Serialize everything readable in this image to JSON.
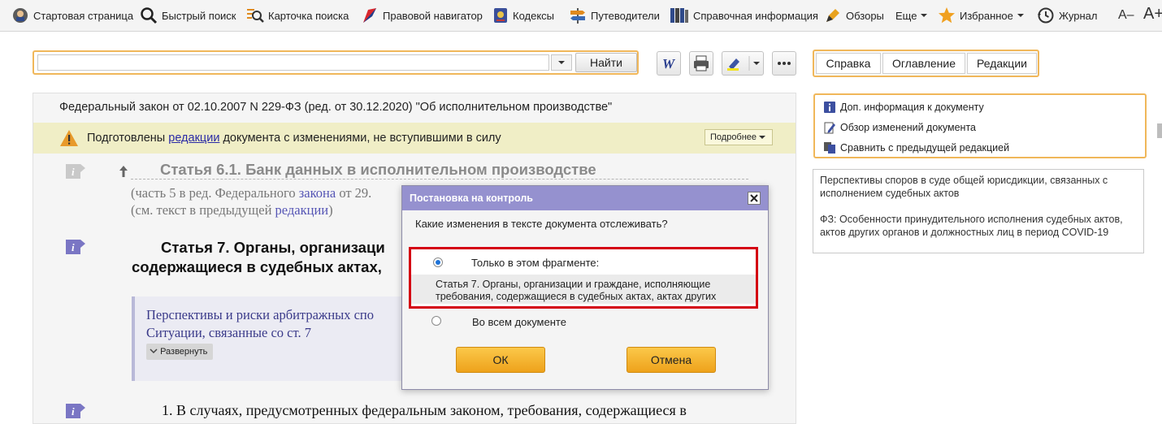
{
  "toolbar": {
    "items": [
      {
        "label": "Стартовая страница",
        "icon": "start-page-icon"
      },
      {
        "label": "Быстрый поиск",
        "icon": "search-icon"
      },
      {
        "label": "Карточка поиска",
        "icon": "search-card-icon"
      },
      {
        "label": "Правовой навигатор",
        "icon": "navigator-icon"
      },
      {
        "label": "Кодексы",
        "icon": "codes-icon"
      },
      {
        "label": "Путеводители",
        "icon": "guides-icon"
      },
      {
        "label": "Справочная информация",
        "icon": "reference-icon"
      },
      {
        "label": "Обзоры",
        "icon": "reviews-icon"
      },
      {
        "label": "Еще",
        "icon": "chevron-down-icon"
      },
      {
        "label": "Избранное",
        "icon": "star-icon"
      },
      {
        "label": "Журнал",
        "icon": "history-icon"
      }
    ],
    "font_decrease": "A–",
    "font_increase": "A+"
  },
  "search": {
    "value": "",
    "button_label": "Найти"
  },
  "right_tabs": [
    "Справка",
    "Оглавление",
    "Редакции"
  ],
  "document": {
    "title": "Федеральный закон от 02.10.2007 N 229-ФЗ (ред. от 30.12.2020) \"Об исполнительном производстве\"",
    "notice": {
      "before": "Подготовлены ",
      "link": "редакции",
      "after": " документа с изменениями, не вступившими в силу",
      "more_button": "Подробнее"
    },
    "article61": {
      "heading": "Статья 6.1. Банк данных в исполнительном производстве",
      "line1_before": "(часть 5 в ред. Федерального ",
      "line1_link": "закона",
      "line1_after": " от 29.",
      "line2_before": "(см. текст в предыдущей ",
      "line2_link": "редакции",
      "line2_after": ")"
    },
    "article7": {
      "line1": "Статья 7. Органы, организаци",
      "line2": "содержащиеся в судебных актах,"
    },
    "comment": {
      "line1": "Перспективы и риски арбитражных спо",
      "line2": "Ситуации, связанные со ст. 7",
      "expand_button": "Развернуть"
    },
    "paragraph1": "1. В случаях, предусмотренных федеральным законом, требования, содержащиеся в"
  },
  "right_panel": {
    "info_links": [
      {
        "label": "Доп. информация к документу",
        "icon": "info-icon"
      },
      {
        "label": "Обзор изменений документа",
        "icon": "edit-doc-icon"
      },
      {
        "label": "Сравнить с предыдущей редакцией",
        "icon": "compare-icon"
      }
    ],
    "related": [
      "Перспективы споров в суде общей юрисдикции, связанных с исполнением судебных актов",
      "ФЗ: Особенности принудительного исполнения судебных актов, актов других органов и должностных лиц в период COVID-19"
    ]
  },
  "dialog": {
    "title": "Постановка на контроль",
    "question": "Какие изменения в тексте документа отслеживать?",
    "option_fragment": "Только в этом фрагменте:",
    "fragment_text": "Статья 7. Органы, организации и граждане, исполняющие требования, содержащиеся в судебных актах, актах других",
    "option_document": "Во всем документе",
    "selected_option": "fragment",
    "ok_label": "ОК",
    "cancel_label": "Отмена"
  },
  "colors": {
    "accent_border": "#f0b75a",
    "dialog_header": "#9591cf",
    "highlight_frame": "#d40012",
    "button_orange": "#f2b02e",
    "link": "#2a2aa6"
  }
}
